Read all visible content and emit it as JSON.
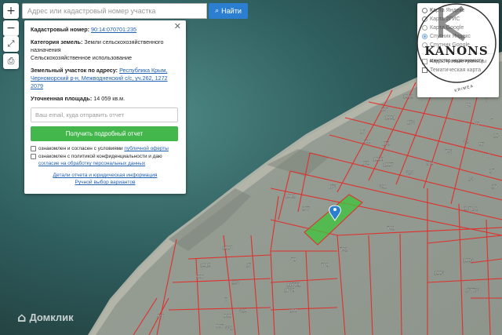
{
  "search": {
    "placeholder": "Адрес или кадастровый номер участка",
    "button_label": "Найти"
  },
  "controls": {
    "zoom_in": "+",
    "zoom_out": "−"
  },
  "info_panel": {
    "cadastral_label": "Кадастровый номер:",
    "cadastral_value": "90:14:070701:235",
    "category_label": "Категория земель:",
    "category_value": "Земли сельскохозяйственного назначения",
    "usage_value": "Сельскохозяйственное использование",
    "address_label": "Земельный участок по адресу:",
    "address_value": "Республика Крым, Черноморский р-н, Межводненский с/с, уч.262, 1272 2079",
    "area_label": "Уточненная площадь:",
    "area_value": "14 059 кв.м.",
    "email_placeholder": "Ваш email, куда отправить отчет",
    "report_button": "Получить подробный отчет",
    "consent1_text": "ознакомлен и согласен с условиями",
    "consent1_link": "публичной оферты",
    "consent2_text": "ознакомлен с политикой конфиденциальности и даю",
    "consent2_link": "согласие на обработку персональных данных",
    "link1": "Детали отчета и юридическая информация",
    "link2": "Ручной выбор вариантов"
  },
  "layers": {
    "options": [
      {
        "label": "Карта Яндекс",
        "selected": false
      },
      {
        "label": "Карта 2ГИС",
        "selected": false
      },
      {
        "label": "Карта Google",
        "selected": false
      },
      {
        "label": "Спутник Яндекс",
        "selected": true
      },
      {
        "label": "Спутник Google",
        "selected": false
      }
    ],
    "overlays": [
      {
        "label": "Кадастровые границы"
      },
      {
        "label": "Тематическая карта"
      }
    ]
  },
  "logo": {
    "name": "KANONS",
    "tagline": "агентство недвижимости",
    "region": "KRIMEA"
  },
  "watermark": {
    "text": "Домклик"
  },
  "parcels": [
    "1012",
    "1001",
    "995",
    "174",
    "999",
    "172",
    "16",
    "1000",
    "1007",
    "170",
    "324",
    "250",
    "173",
    "301",
    "267",
    "592",
    "1012",
    "1008",
    "1010",
    "17",
    "592",
    "589",
    "224",
    "50",
    "1650/1",
    "7",
    "429",
    "299",
    "999",
    "997",
    "431",
    "2151/1",
    "1004",
    "1003",
    "1757/3",
    "593",
    "89",
    "65",
    "97",
    "42",
    "88",
    "5",
    "15",
    "14",
    "25",
    "8",
    "6",
    "10",
    "9",
    "13",
    "12",
    "11",
    "1650",
    "1630",
    "996",
    "998"
  ],
  "colors": {
    "parcel_border": "#e0302c",
    "highlight": "#3ec43e",
    "marker": "#2c7fd0",
    "button_blue": "#2c7fd0",
    "button_green": "#43b64c"
  }
}
